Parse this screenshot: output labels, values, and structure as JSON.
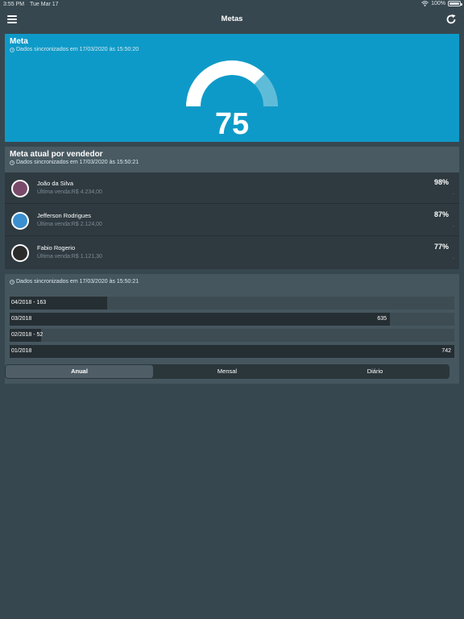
{
  "status_bar": {
    "time": "3:55 PM",
    "date": "Tue Mar 17",
    "battery": "100%"
  },
  "nav": {
    "title": "Metas",
    "menu_icon": "hamburger-icon",
    "refresh_icon": "refresh-icon"
  },
  "meta_card": {
    "title": "Meta",
    "sync": "Dados sincronizados em 17/03/2020 às 15:50:20",
    "gauge_value": "75",
    "gauge_fraction": 0.75,
    "colors": {
      "background": "#0e9ac8",
      "arc_filled": "#ffffff",
      "arc_remaining": "#5fbcd9"
    }
  },
  "sellers_card": {
    "title": "Meta atual por vendedor",
    "sync": "Dados sincronizados em 17/03/2020 às 15:50:21",
    "sellers": [
      {
        "name": "João da Silva",
        "last_sale": "Última venda:R$ 4.234,00",
        "percent": "98%",
        "dot": "."
      },
      {
        "name": "Jefferson Rodrigues",
        "last_sale": "Última venda:R$ 2.124,00",
        "percent": "87%",
        "dot": "."
      },
      {
        "name": "Fabio Rogerio",
        "last_sale": "Última venda:R$ 1.121,30",
        "percent": "77%",
        "dot": "."
      }
    ]
  },
  "bars_card": {
    "sync": "Dados sincronizados em 17/03/2020 às 15:50:21",
    "max": 742,
    "rows": [
      {
        "label": "04/2018 - 163",
        "value": 163,
        "value_label": ""
      },
      {
        "label": "03/2018",
        "value": 635,
        "value_label": "635"
      },
      {
        "label": "02/2018 - 52",
        "value": 52,
        "value_label": ""
      },
      {
        "label": "01/2018",
        "value": 742,
        "value_label": "742"
      }
    ],
    "segments": [
      {
        "label": "Anual",
        "active": true
      },
      {
        "label": "Mensal",
        "active": false
      },
      {
        "label": "Diário",
        "active": false
      }
    ]
  }
}
